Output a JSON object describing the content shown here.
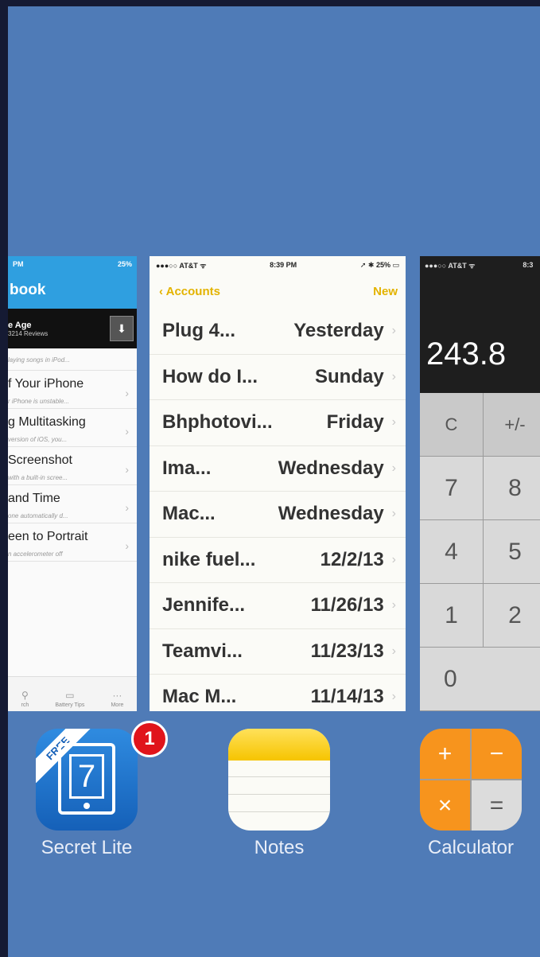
{
  "secret_card": {
    "status_time": "PM",
    "status_right": "25%",
    "nav_title": "book",
    "banner_title": "e Age",
    "banner_sub": "3214 Reviews",
    "first_line": "laying songs in iPod...",
    "items": [
      {
        "title": "f Your iPhone",
        "sub": "r iPhone is unstable..."
      },
      {
        "title": "g Multitasking",
        "sub": "version of iOS, you..."
      },
      {
        "title": "Screenshot",
        "sub": "with a built-in scree..."
      },
      {
        "title": "and Time",
        "sub": "one automatically d..."
      },
      {
        "title": "een to Portrait",
        "sub": "n accelerometer off"
      }
    ],
    "tabs": [
      "rch",
      "Battery Tips",
      "More"
    ]
  },
  "notes_card": {
    "carrier": "AT&T",
    "time": "8:39 PM",
    "battery": "25%",
    "back_label": "Accounts",
    "new_label": "New",
    "notes": [
      {
        "title": "Plug 4...",
        "date": "Yesterday"
      },
      {
        "title": "How do I...",
        "date": "Sunday"
      },
      {
        "title": "Bhphotovi...",
        "date": "Friday"
      },
      {
        "title": "Ima...",
        "date": "Wednesday"
      },
      {
        "title": "Mac...",
        "date": "Wednesday"
      },
      {
        "title": "nike fuel...",
        "date": "12/2/13"
      },
      {
        "title": "Jennife...",
        "date": "11/26/13"
      },
      {
        "title": "Teamvi...",
        "date": "11/23/13"
      },
      {
        "title": "Mac M...",
        "date": "11/14/13"
      }
    ]
  },
  "calc_card": {
    "carrier": "AT&T",
    "time": "8:3",
    "display": "243.8",
    "keys": [
      [
        "C",
        "+/-"
      ],
      [
        "7",
        "8"
      ],
      [
        "4",
        "5"
      ],
      [
        "1",
        "2"
      ],
      [
        "0"
      ]
    ]
  },
  "apps": [
    {
      "label": "Secret Lite",
      "badge": "1",
      "ribbon": "FREE",
      "glyph": "7"
    },
    {
      "label": "Notes"
    },
    {
      "label": "Calculator",
      "glyphs": [
        "+",
        "−",
        "×",
        "="
      ]
    }
  ],
  "colors": {
    "background": "#4f7bb7",
    "notes_accent": "#e3b300",
    "secret_accent": "#2f9fe0",
    "calc_orange": "#f7941d",
    "badge_red": "#e0141b"
  }
}
